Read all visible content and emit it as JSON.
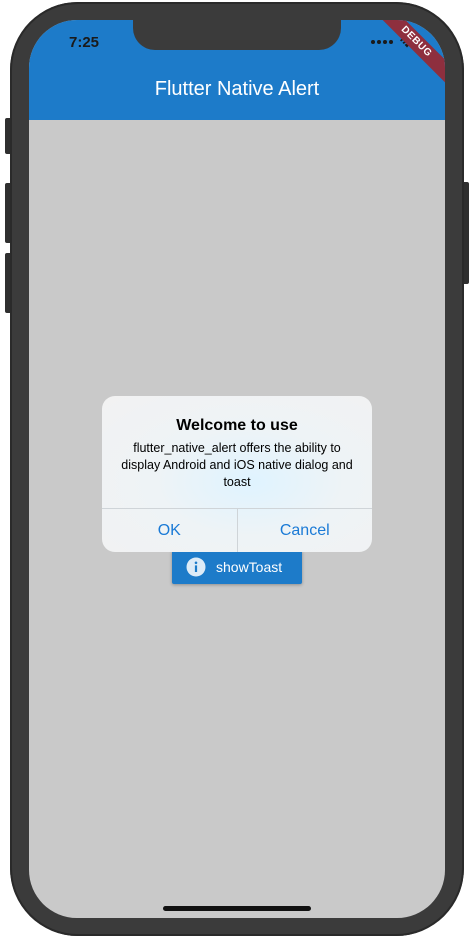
{
  "status_bar": {
    "time": "7:25"
  },
  "debug_banner": "DEBUG",
  "app_bar": {
    "title": "Flutter Native Alert"
  },
  "dialog": {
    "title": "Welcome to use",
    "message": "flutter_native_alert offers the ability to display Android and iOS native dialog and toast",
    "ok_label": "OK",
    "cancel_label": "Cancel"
  },
  "toast_button": {
    "label": "showToast",
    "icon": "info-icon"
  },
  "colors": {
    "primary": "#1d7bc9",
    "background": "#c9c9c9",
    "dialog_action": "#1a7ad6",
    "debug_banner": "#8e2f3e"
  }
}
